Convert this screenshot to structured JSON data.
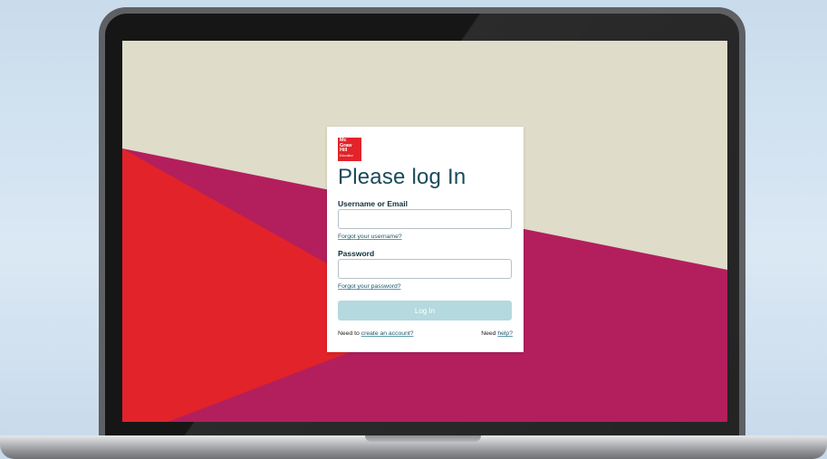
{
  "brand": {
    "logo_lines": [
      "Mc",
      "Graw",
      "Hill",
      "Education"
    ],
    "logo_color": "#e2232a"
  },
  "login": {
    "title": "Please log In",
    "username_label": "Username or Email",
    "username_value": "",
    "forgot_username": "Forgot your username?",
    "password_label": "Password",
    "password_value": "",
    "forgot_password": "Forgot your password?",
    "login_button": "Log In",
    "footer_need_left": "Need to",
    "create_account": "create an account?",
    "footer_need_right": "Need",
    "help": "help?"
  },
  "colors": {
    "background": "#dfdcca",
    "red_shape": "#e2232a",
    "magenta_shape": "#b31f5c",
    "title_color": "#1b4a5b",
    "button_disabled": "#b4d9de"
  }
}
